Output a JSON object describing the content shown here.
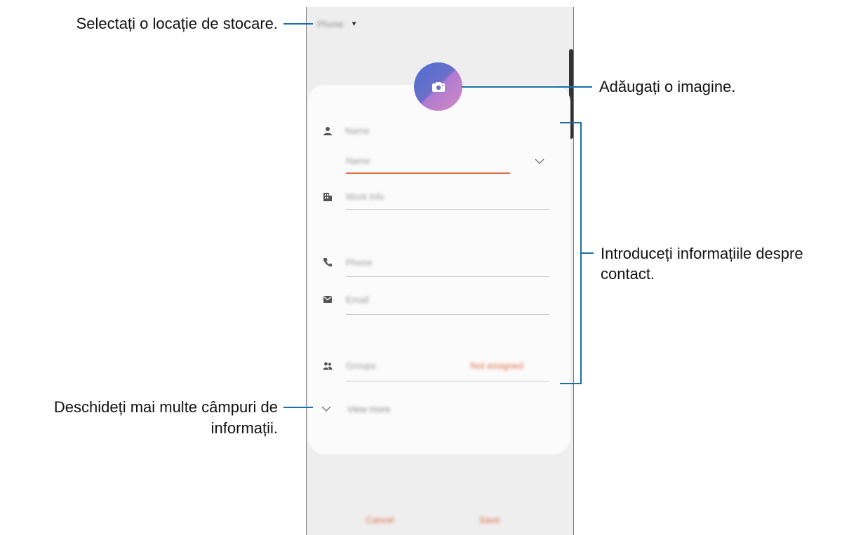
{
  "annotations": {
    "select_storage": "Selectați o locație de stocare.",
    "add_image": "Adăugați o imagine.",
    "enter_info_line1": "Introduceți informațiile despre",
    "enter_info_line2": "contact.",
    "more_fields_line1": "Deschideți mai multe câmpuri de",
    "more_fields_line2": "informații."
  },
  "screen": {
    "storage": {
      "label": "Phone",
      "icon": "caret-down-icon"
    },
    "photo": {
      "icon": "camera-icon"
    },
    "fields": {
      "name": {
        "label": "Name",
        "icon": "person-icon"
      },
      "name_input": {
        "placeholder": "Name",
        "icon": "chevron-down-icon"
      },
      "work": {
        "label": "Work info",
        "icon": "building-icon"
      },
      "phone": {
        "label": "Phone",
        "icon": "phone-icon"
      },
      "email": {
        "label": "Email",
        "icon": "mail-icon"
      },
      "groups": {
        "label": "Groups",
        "value": "Not assigned",
        "icon": "group-icon"
      }
    },
    "view_more": {
      "label": "View more",
      "icon": "chevron-down-icon"
    },
    "actions": {
      "cancel": "Cancel",
      "save": "Save"
    }
  },
  "colors": {
    "accent": "#e66a3c",
    "leader_lines": "#1a6fa8",
    "phone_background": "#eeeeee",
    "card_background": "#fbfbfb"
  }
}
